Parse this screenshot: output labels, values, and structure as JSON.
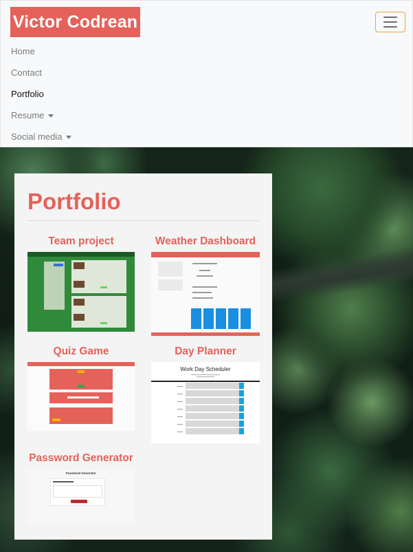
{
  "navbar": {
    "brand": "Victor Codrean",
    "toggler_icon": "hamburger-icon",
    "items": [
      {
        "label": "Home",
        "dropdown": false,
        "active": false
      },
      {
        "label": "Contact",
        "dropdown": false,
        "active": false
      },
      {
        "label": "Portfolio",
        "dropdown": false,
        "active": true
      },
      {
        "label": "Resume",
        "dropdown": true,
        "active": false
      },
      {
        "label": "Social media",
        "dropdown": true,
        "active": false
      }
    ]
  },
  "portfolio": {
    "title": "Portfolio",
    "projects": [
      {
        "title": "Team project"
      },
      {
        "title": "Weather Dashboard"
      },
      {
        "title": "Quiz Game"
      },
      {
        "title": "Day Planner"
      },
      {
        "title": "Password Generator"
      }
    ],
    "thumb_text": {
      "planner_title": "Work Day Scheduler",
      "password_title": "Password Generator"
    }
  },
  "colors": {
    "accent": "#e4625a",
    "navbar_bg": "#f8f9fa",
    "card_bg": "#f4f4f4",
    "toggler_border": "#e8a63a"
  }
}
